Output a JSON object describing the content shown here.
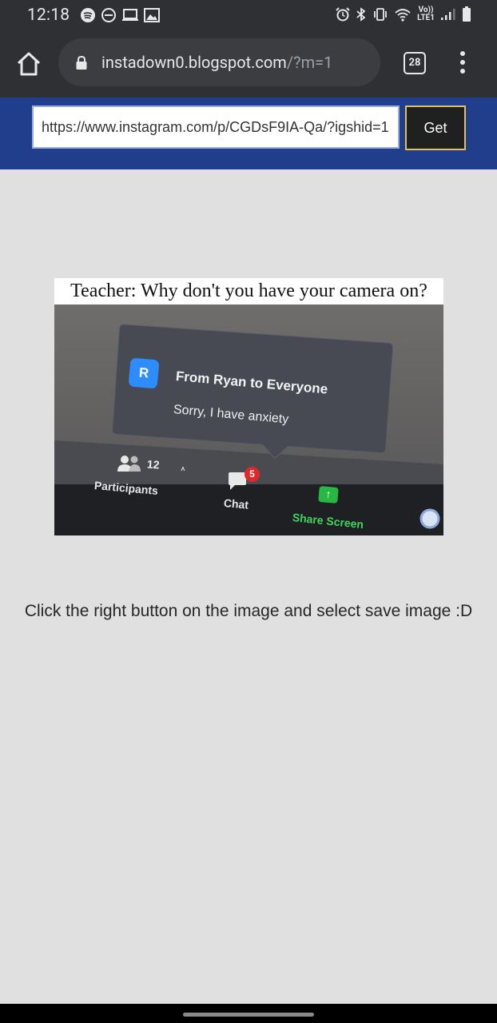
{
  "status_bar": {
    "time": "12:18",
    "volte_label": "Vo))",
    "lte_label": "LTE1"
  },
  "browser": {
    "url_domain": "instadown0.blogspot.com",
    "url_path": "/?m=1",
    "tab_count": "28"
  },
  "downloader": {
    "url_value": "https://www.instagram.com/p/CGDsF9IA-Qa/?igshid=1",
    "get_label": "Get"
  },
  "meme": {
    "caption": "Teacher: Why don't you have your camera on?",
    "avatar_letter": "R",
    "chat_from": "From Ryan to Everyone",
    "chat_message": "Sorry, I have anxiety",
    "participants_count": "12",
    "participants_label": "Participants",
    "chat_badge": "5",
    "chat_label": "Chat",
    "share_label": "Share Screen"
  },
  "instructions": "Click the right button on the image and select save image :D"
}
